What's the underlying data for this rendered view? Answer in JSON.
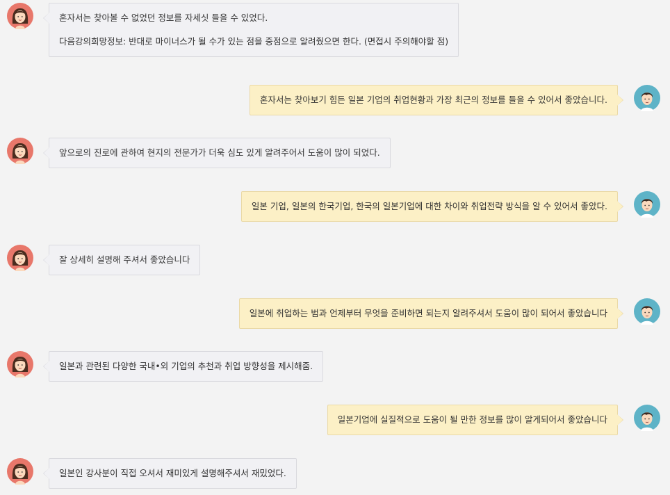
{
  "messages": [
    {
      "side": "left",
      "lines": [
        "혼자서는 찾아볼 수 없었던 정보를 자세싯 들을 수 있었다.",
        "다음강의희망정보: 반대로 마이너스가 될 수가 있는 점을 중점으로 알려줬으면 한다. (면접시 주의해야할 점)"
      ]
    },
    {
      "side": "right",
      "lines": [
        "혼자서는 찾아보기 힘든 일본 기업의 취업현황과 가장 최근의 정보를 들을 수 있어서 좋았습니다."
      ]
    },
    {
      "side": "left",
      "lines": [
        "앞으로의 진로에 관하여 현지의 전문가가 더욱 심도 있게 알려주어서 도움이 많이 되었다."
      ]
    },
    {
      "side": "right",
      "lines": [
        "일본 기업, 일본의 한국기업, 한국의 일본기업에 대한 차이와 취업전략 방식을 알 수 있어서 좋았다."
      ]
    },
    {
      "side": "left",
      "lines": [
        "잘 상세히 설명해 주셔서 좋았습니다"
      ]
    },
    {
      "side": "right",
      "lines": [
        "일본에 취업하는 범과 언제부터 무엇을 준비하면 되는지 알려주셔서 도움이 많이 되어서 좋았습니다"
      ]
    },
    {
      "side": "left",
      "lines": [
        "일본과 관련된 다양한 국내•외 기업의 추천과 취업 방향성을 제시해줌."
      ]
    },
    {
      "side": "right",
      "lines": [
        "일본기업에 실질적으로 도움이 될 만한 정보를 많이 알게되어서 좋았습니다"
      ]
    },
    {
      "side": "left",
      "lines": [
        "일본인 강사분이 직접 오셔서 재미있게 설명해주셔서 재밌었다."
      ]
    }
  ],
  "colors": {
    "background": "#f3f3f3",
    "left_bubble": "#f1f1f4",
    "right_bubble": "#fcf0c6"
  },
  "icons": {
    "left_avatar": "female-avatar-icon",
    "right_avatar": "male-avatar-icon"
  }
}
